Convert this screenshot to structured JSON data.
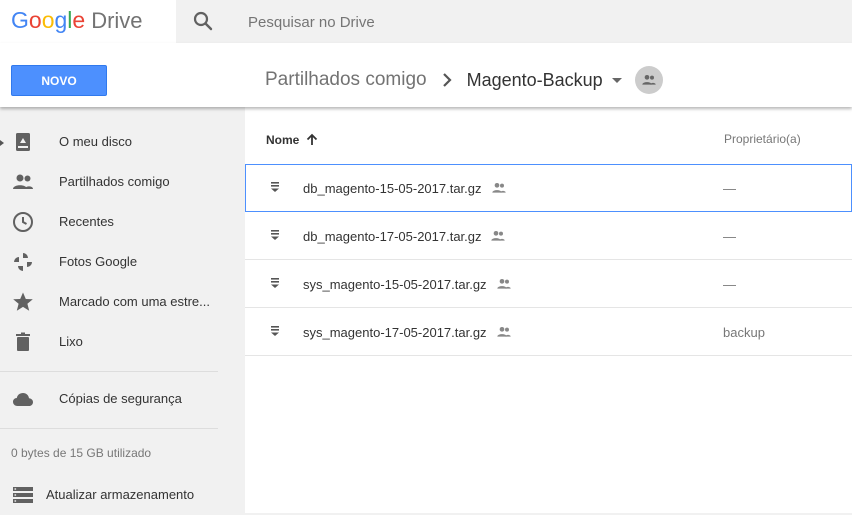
{
  "app": {
    "logo_google": [
      "G",
      "o",
      "o",
      "g",
      "l",
      "e"
    ],
    "logo_product": "Drive"
  },
  "search": {
    "placeholder": "Pesquisar no Drive",
    "value": ""
  },
  "toolbar": {
    "new_label": "NOVO"
  },
  "breadcrumb": {
    "root": "Partilhados comigo",
    "current": "Magento-Backup"
  },
  "sidebar": {
    "items": [
      {
        "label": "O meu disco",
        "icon": "drive-icon"
      },
      {
        "label": "Partilhados comigo",
        "icon": "shared-people-icon"
      },
      {
        "label": "Recentes",
        "icon": "clock-icon"
      },
      {
        "label": "Fotos Google",
        "icon": "photos-pinwheel-icon"
      },
      {
        "label": "Marcado com uma estre...",
        "icon": "star-icon"
      },
      {
        "label": "Lixo",
        "icon": "trash-icon"
      }
    ],
    "backup": {
      "label": "Cópias de segurança",
      "icon": "cloud-icon"
    },
    "storage_text": "0 bytes de 15 GB utilizado",
    "upgrade": {
      "label": "Atualizar armazenamento",
      "icon": "storage-icon"
    }
  },
  "table": {
    "columns": {
      "name": "Nome",
      "owner": "Proprietário(a)"
    },
    "sort": "ascending",
    "rows": [
      {
        "name": "db_magento-15-05-2017.tar.gz",
        "owner": "—",
        "shared": true,
        "selected": true
      },
      {
        "name": "db_magento-17-05-2017.tar.gz",
        "owner": "—",
        "shared": true,
        "selected": false
      },
      {
        "name": "sys_magento-15-05-2017.tar.gz",
        "owner": "—",
        "shared": true,
        "selected": false
      },
      {
        "name": "sys_magento-17-05-2017.tar.gz",
        "owner": "backup",
        "shared": true,
        "selected": false
      }
    ]
  },
  "colors": {
    "accent": "#4d90fe",
    "sidebar_bg": "#f1f1f1",
    "icon": "#616161"
  }
}
